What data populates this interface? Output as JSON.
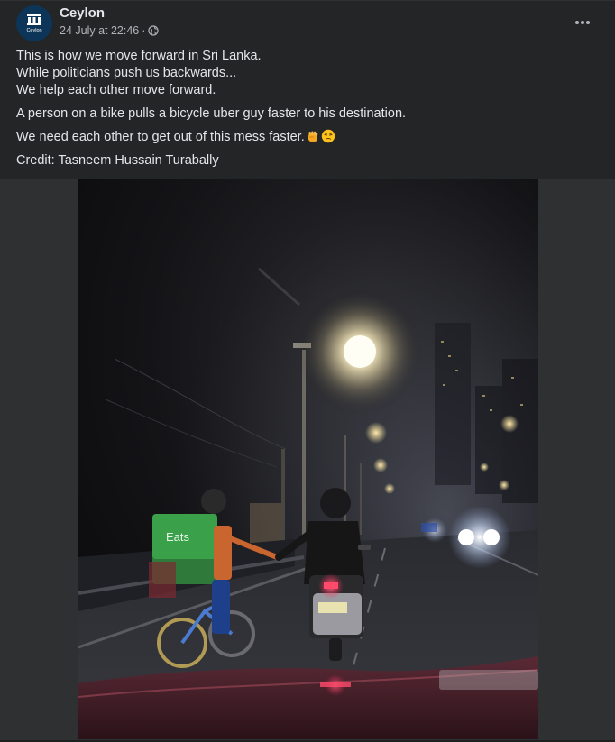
{
  "post": {
    "page_name": "Ceylon",
    "avatar_text": "Ceylon",
    "timestamp": "24 July at 22:46",
    "meta_separator": "·",
    "audience_icon": "globe-icon",
    "more_icon": "more-options-icon",
    "body": {
      "paragraph_1": [
        "This is how we move forward in Sri Lanka.",
        "While politicians push us backwards...",
        "We help each other move forward."
      ],
      "paragraph_2": "A person on a bike pulls a bicycle uber guy faster to his destination.",
      "paragraph_3": "We need each other to get out of this mess faster.",
      "paragraph_3_emojis": [
        "raised-fist-emoji",
        "persevering-face-emoji"
      ],
      "paragraph_4": "Credit: Tasneem Hussain Turabally"
    },
    "photo": {
      "bag_text": "Eats"
    }
  },
  "colors": {
    "card_background": "#242526",
    "page_background": "#18191a",
    "primary_text": "#e4e6eb",
    "secondary_text": "#b0b3b8",
    "avatar_background": "#0c3557"
  }
}
